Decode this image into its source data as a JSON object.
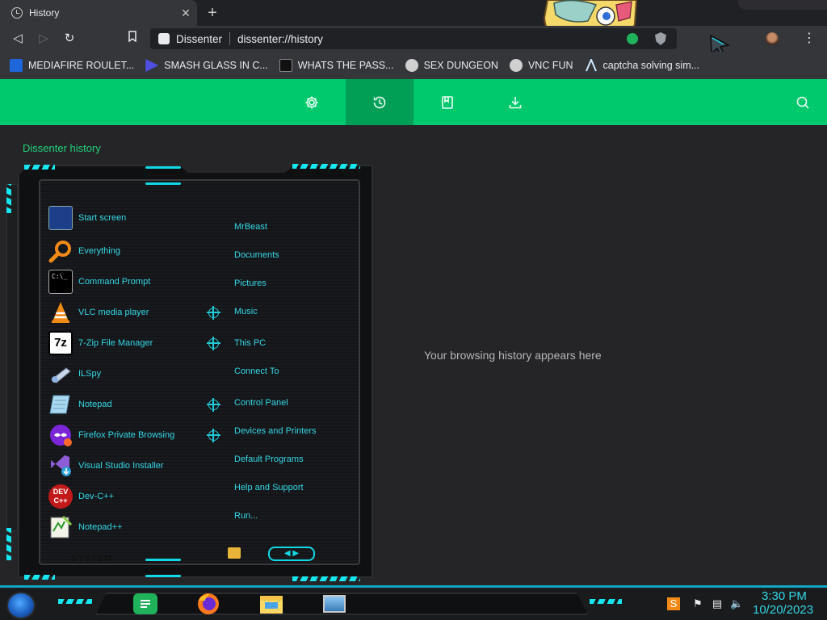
{
  "browser": {
    "tab": {
      "title": "History",
      "close": "✕"
    },
    "new_tab": "+",
    "address": {
      "site_name": "Dissenter",
      "url": "dissenter://history"
    },
    "bookmarks": [
      {
        "label": "MEDIAFIRE ROULET...",
        "color": "#1e66d9"
      },
      {
        "label": "SMASH GLASS IN C...",
        "color": "#4f4fe0"
      },
      {
        "label": "WHATS THE PASS...",
        "color": "#202124"
      },
      {
        "label": "SEX DUNGEON",
        "color": "#d0d0d0"
      },
      {
        "label": "VNC FUN",
        "color": "#d0d0d0"
      },
      {
        "label": "captcha solving sim...",
        "color": "#35363a"
      }
    ]
  },
  "dissenter": {
    "accent": "#00c86d",
    "accent_active": "#009f55",
    "nav": [
      {
        "icon": "gear-icon"
      },
      {
        "icon": "history-icon",
        "active": true
      },
      {
        "icon": "bookmark-icon"
      },
      {
        "icon": "download-icon"
      }
    ],
    "history_title": "Dissenter history",
    "empty_message": "Your browsing history appears here"
  },
  "start_menu": {
    "programs": [
      {
        "label": "Start screen",
        "icon": "start-screen-icon"
      },
      {
        "label": "Everything",
        "icon": "everything-icon"
      },
      {
        "label": "Command Prompt",
        "icon": "command-prompt-icon"
      },
      {
        "label": "VLC media player",
        "icon": "vlc-icon"
      },
      {
        "label": "7-Zip File Manager",
        "icon": "7zip-icon"
      },
      {
        "label": "ILSpy",
        "icon": "ilspy-icon"
      },
      {
        "label": "Notepad",
        "icon": "notepad-icon"
      },
      {
        "label": "Firefox Private Browsing",
        "icon": "firefox-private-icon"
      },
      {
        "label": "Visual Studio Installer",
        "icon": "visual-studio-installer-icon"
      },
      {
        "label": "Dev-C++",
        "icon": "devcpp-icon"
      },
      {
        "label": "Notepad++",
        "icon": "notepadpp-icon"
      }
    ],
    "places": [
      "MrBeast",
      "Documents",
      "Pictures",
      "Music",
      "This PC",
      "Connect To",
      "Control Panel",
      "Devices and Printers",
      "Default Programs",
      "Help and Support",
      "Run..."
    ],
    "footer_label": "SYSTEM",
    "text_color": "#33d7e6"
  },
  "taskbar": {
    "pinned": [
      "notes-app-icon",
      "firefox-icon",
      "file-explorer-icon",
      "photos-icon"
    ],
    "tray": [
      "sublime-icon",
      "flag-icon",
      "network-icon",
      "volume-icon"
    ],
    "clock": {
      "time": "3:30 PM",
      "date": "10/20/2023"
    }
  }
}
